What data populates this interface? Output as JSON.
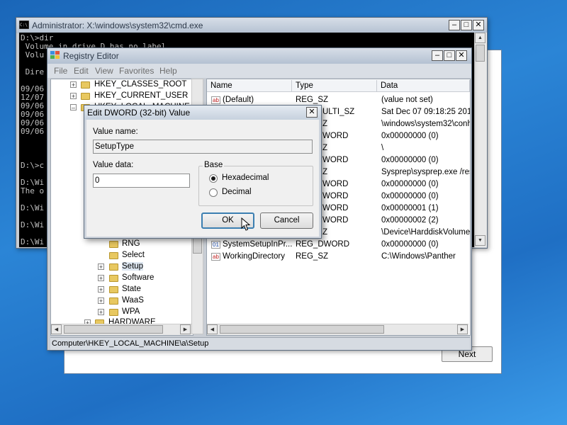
{
  "setup_window": {
    "next_label": "Next"
  },
  "cmd_window": {
    "title": "Administrator: X:\\windows\\system32\\cmd.exe",
    "icon": "cmd-icon",
    "lines": [
      "D:\\>dir",
      " Volume in drive D has no label",
      " Volu",
      "",
      " Dire",
      "",
      "09/06",
      "12/07",
      "09/06",
      "09/06",
      "09/06",
      "09/06",
      "",
      "",
      "",
      "D:\\>c",
      "",
      "D:\\Wi",
      "The o",
      "",
      "D:\\Wi",
      "",
      "D:\\Wi",
      "",
      "D:\\Wi"
    ]
  },
  "registry": {
    "title": "Registry Editor",
    "menu": [
      "File",
      "Edit",
      "View",
      "Favorites",
      "Help"
    ],
    "tree": {
      "top": [
        {
          "label": "HKEY_CLASSES_ROOT"
        },
        {
          "label": "HKEY_CURRENT_USER"
        },
        {
          "label": "HKEY_LOCAL_MACHINE"
        }
      ],
      "children": [
        {
          "label": "RNG",
          "expandable": false
        },
        {
          "label": "Select",
          "expandable": false
        },
        {
          "label": "Setup",
          "expandable": true
        },
        {
          "label": "Software",
          "expandable": true
        },
        {
          "label": "State",
          "expandable": true
        },
        {
          "label": "WaaS",
          "expandable": true
        },
        {
          "label": "WPA",
          "expandable": true
        }
      ],
      "hardware": "HARDWARE"
    },
    "columns": [
      "Name",
      "Type",
      "Data"
    ],
    "rows": [
      {
        "name": "(Default)",
        "type": "REG_SZ",
        "data": "(value not set)",
        "icon": "string-value-icon"
      },
      {
        "name": "",
        "type": "ULTI_SZ",
        "data": "Sat Dec 07 09:18:25 2019",
        "icon": ""
      },
      {
        "name": "",
        "type": "Z",
        "data": "\\windows\\system32\\conh",
        "icon": ""
      },
      {
        "name": "",
        "type": "WORD",
        "data": "0x00000000 (0)",
        "icon": ""
      },
      {
        "name": "",
        "type": "Z",
        "data": "\\",
        "icon": ""
      },
      {
        "name": "",
        "type": "WORD",
        "data": "0x00000000 (0)",
        "icon": ""
      },
      {
        "name": "",
        "type": "Z",
        "data": "Sysprep\\sysprep.exe /res",
        "icon": ""
      },
      {
        "name": "",
        "type": "WORD",
        "data": "0x00000000 (0)",
        "icon": ""
      },
      {
        "name": "",
        "type": "WORD",
        "data": "0x00000000 (0)",
        "icon": ""
      },
      {
        "name": "",
        "type": "WORD",
        "data": "0x00000001 (1)",
        "icon": ""
      },
      {
        "name": "",
        "type": "WORD",
        "data": "0x00000002 (2)",
        "icon": ""
      },
      {
        "name": "",
        "type": "Z",
        "data": "\\Device\\HarddiskVolume1",
        "icon": ""
      },
      {
        "name": "SystemSetupInPr...",
        "type": "REG_DWORD",
        "data": "0x00000000 (0)",
        "icon": "dword-value-icon"
      },
      {
        "name": "WorkingDirectory",
        "type": "REG_SZ",
        "data": "C:\\Windows\\Panther",
        "icon": "string-value-icon"
      }
    ],
    "status": "Computer\\HKEY_LOCAL_MACHINE\\a\\Setup"
  },
  "dialog": {
    "title": "Edit DWORD (32-bit) Value",
    "value_name_label": "Value name:",
    "value_name": "SetupType",
    "value_data_label": "Value data:",
    "value_data": "0",
    "base_label": "Base",
    "hex_label": "Hexadecimal",
    "dec_label": "Decimal",
    "selected_base": "Hexadecimal",
    "ok_label": "OK",
    "cancel_label": "Cancel"
  }
}
